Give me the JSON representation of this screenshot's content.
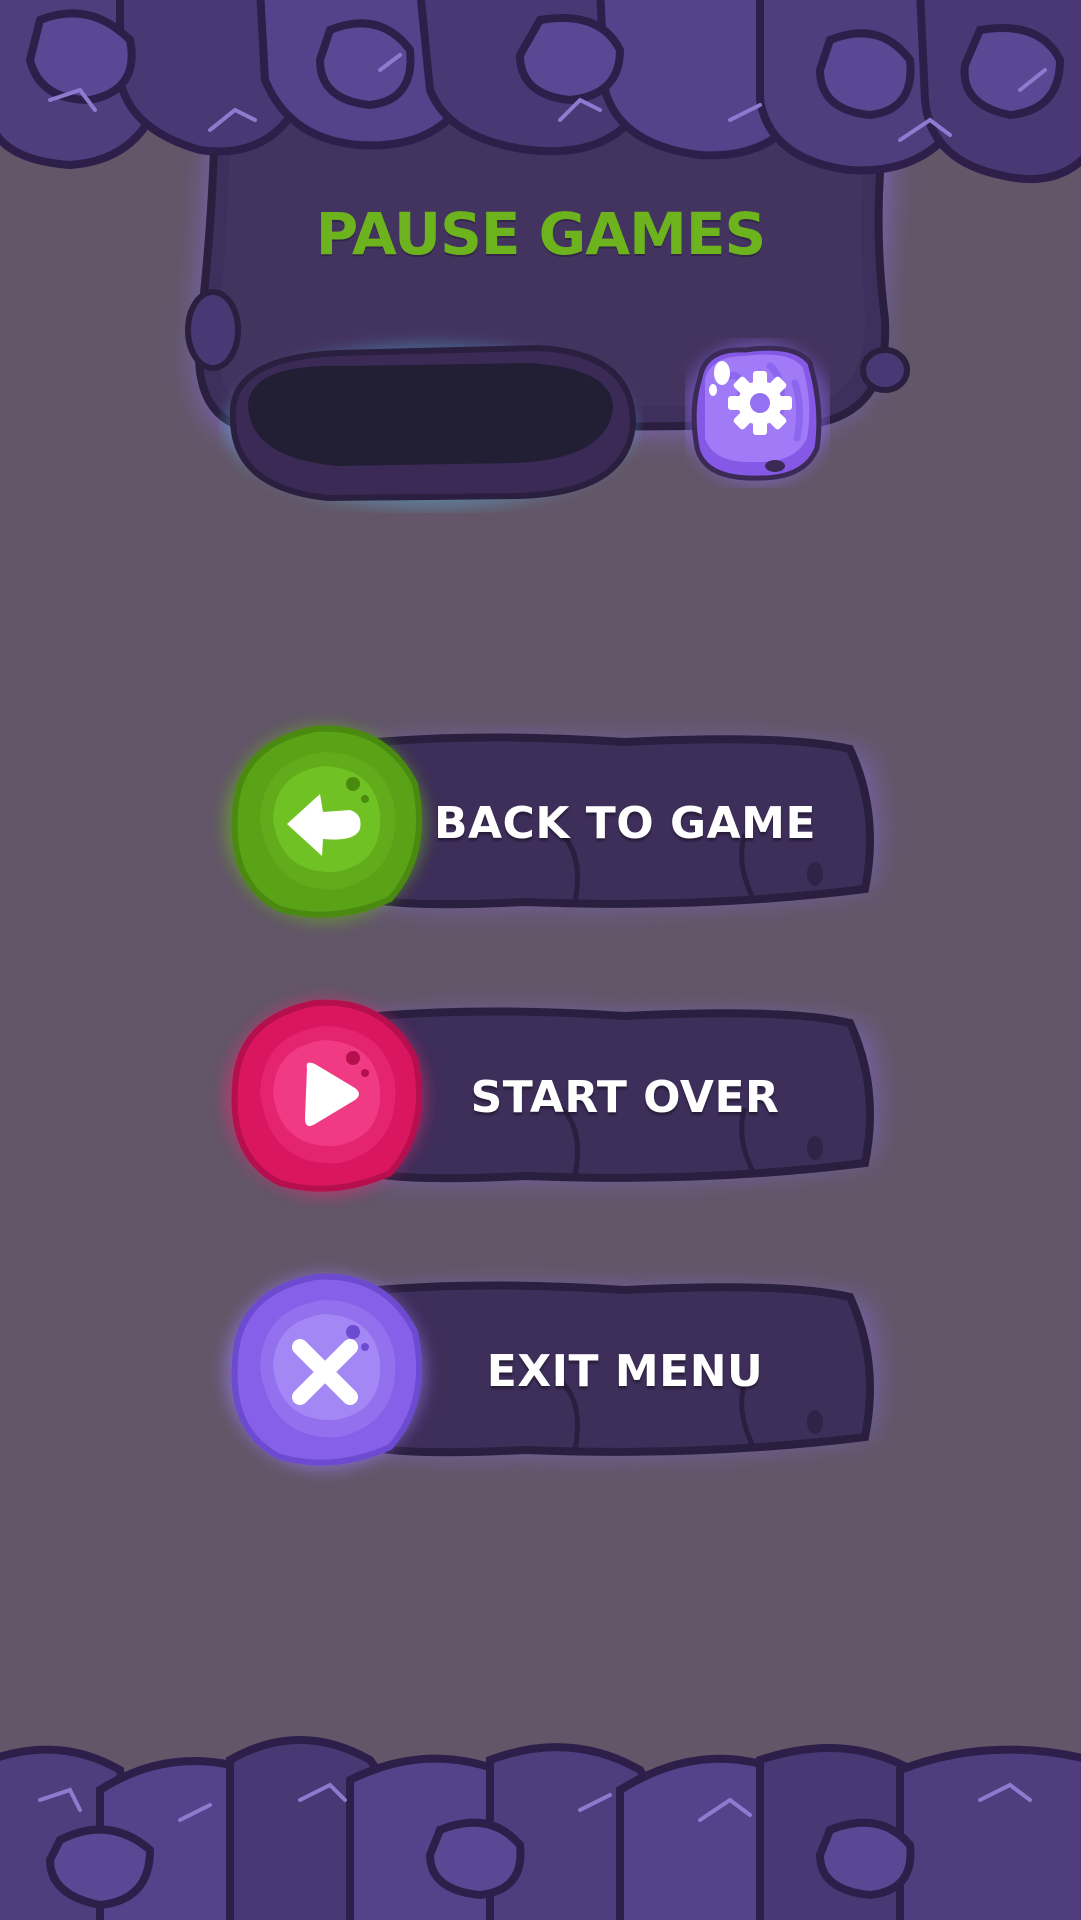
{
  "title": "PAUSE GAMES",
  "settings": {
    "icon": "gear-icon"
  },
  "buttons": [
    {
      "label": "BACK TO GAME",
      "icon": "back-arrow-icon",
      "color": "#6cb81f"
    },
    {
      "label": "START OVER",
      "icon": "play-icon",
      "color": "#ec2a78"
    },
    {
      "label": "EXIT MENU",
      "icon": "close-icon",
      "color": "#9a7bf0"
    }
  ],
  "colors": {
    "background": "#625668",
    "panel": "#3f2f5c",
    "rock": "#4a3874",
    "title": "#6db31e"
  }
}
